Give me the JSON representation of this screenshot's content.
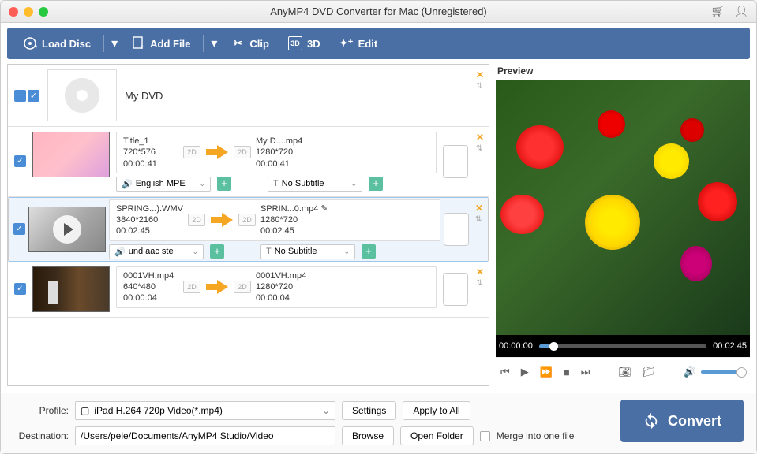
{
  "window": {
    "title": "AnyMP4 DVD Converter for Mac (Unregistered)"
  },
  "toolbar": {
    "load_disc": "Load Disc",
    "add_file": "Add File",
    "clip": "Clip",
    "three_d": "3D",
    "edit": "Edit"
  },
  "group": {
    "name": "My DVD"
  },
  "items": [
    {
      "src": {
        "name": "Title_1",
        "res": "720*576",
        "dur": "00:00:41"
      },
      "dst": {
        "name": "My D....mp4",
        "res": "1280*720",
        "dur": "00:00:41"
      },
      "audio": "English MPE",
      "subtitle": "No Subtitle",
      "selected": false
    },
    {
      "src": {
        "name": "SPRING...).WMV",
        "res": "3840*2160",
        "dur": "00:02:45"
      },
      "dst": {
        "name": "SPRIN...0.mp4",
        "res": "1280*720",
        "dur": "00:02:45"
      },
      "audio": "und aac ste",
      "subtitle": "No Subtitle",
      "selected": true
    },
    {
      "src": {
        "name": "0001VH.mp4",
        "res": "640*480",
        "dur": "00:00:04"
      },
      "dst": {
        "name": "0001VH.mp4",
        "res": "1280*720",
        "dur": "00:00:04"
      },
      "audio": "",
      "subtitle": "",
      "selected": false
    }
  ],
  "profile": {
    "label": "Profile:",
    "value": "iPad H.264 720p Video(*.mp4)",
    "settings": "Settings",
    "apply": "Apply to All"
  },
  "dest": {
    "label": "Destination:",
    "value": "/Users/pele/Documents/AnyMP4 Studio/Video",
    "browse": "Browse",
    "open": "Open Folder",
    "merge": "Merge into one file"
  },
  "convert": "Convert",
  "preview": {
    "label": "Preview",
    "start": "00:00:00",
    "end": "00:02:45"
  }
}
